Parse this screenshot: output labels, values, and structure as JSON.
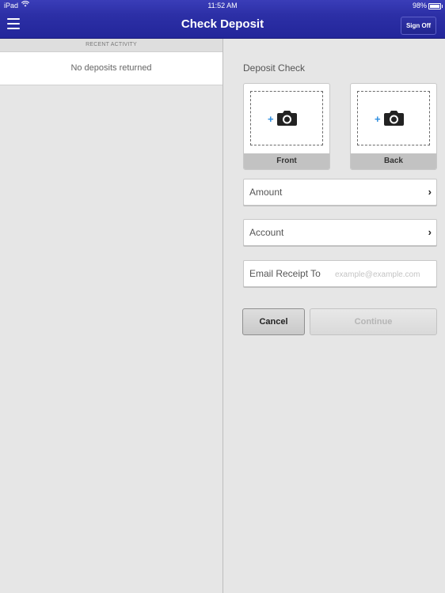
{
  "status_bar": {
    "carrier": "iPad",
    "wifi_icon": "wifi-icon",
    "time": "11:52 AM",
    "battery": "98%"
  },
  "header": {
    "title": "Check Deposit",
    "sign_off": "Sign Off",
    "menu_icon": "hamburger-menu-icon"
  },
  "recent": {
    "header": "RECENT ACTIVITY",
    "empty_text": "No deposits returned"
  },
  "deposit": {
    "section_label": "Deposit Check",
    "front_label": "Front",
    "back_label": "Back",
    "camera_icon": "add-camera-icon",
    "amount_label": "Amount",
    "account_label": "Account",
    "email_label": "Email Receipt To",
    "email_value": "",
    "email_placeholder": "example@example.com",
    "cancel_label": "Cancel",
    "continue_label": "Continue"
  },
  "colors": {
    "header_blue": "#2c2fa6",
    "accent_blue": "#2d8ee0",
    "background": "#e6e6e6"
  }
}
